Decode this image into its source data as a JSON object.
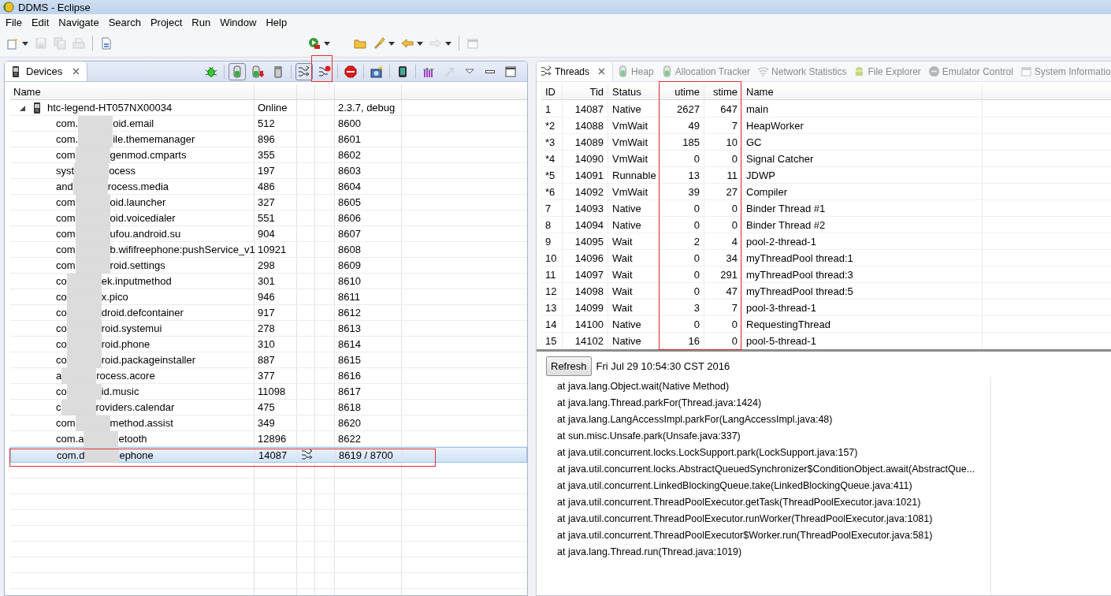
{
  "window": {
    "title": "DDMS - Eclipse"
  },
  "menu": [
    "File",
    "Edit",
    "Navigate",
    "Search",
    "Project",
    "Run",
    "Window",
    "Help"
  ],
  "main_toolbar": [
    {
      "kind": "new",
      "dropdown": true,
      "disabled": false
    },
    {
      "kind": "save",
      "dropdown": false,
      "disabled": true
    },
    {
      "kind": "save-all",
      "dropdown": false,
      "disabled": true
    },
    {
      "kind": "print",
      "dropdown": false,
      "disabled": true
    },
    {
      "kind": "separator"
    },
    {
      "kind": "document",
      "dropdown": false,
      "disabled": false
    },
    {
      "kind": "gap"
    },
    {
      "kind": "run",
      "dropdown": true,
      "disabled": false
    },
    {
      "kind": "gap-small"
    },
    {
      "kind": "folder",
      "dropdown": false,
      "disabled": false
    },
    {
      "kind": "torch",
      "dropdown": true,
      "disabled": false
    },
    {
      "kind": "back",
      "dropdown": true,
      "disabled": false
    },
    {
      "kind": "forward",
      "dropdown": true,
      "disabled": true
    },
    {
      "kind": "separator"
    },
    {
      "kind": "window",
      "dropdown": false,
      "disabled": true
    }
  ],
  "devices": {
    "tab": {
      "label": "Devices"
    },
    "toolbar": [
      {
        "kind": "bug",
        "pressed": false,
        "disabled": false
      },
      {
        "kind": "separator"
      },
      {
        "kind": "heap",
        "pressed": true,
        "disabled": false
      },
      {
        "kind": "dump",
        "pressed": false,
        "disabled": false
      },
      {
        "kind": "gc",
        "pressed": false,
        "disabled": false
      },
      {
        "kind": "separator"
      },
      {
        "kind": "threads",
        "pressed": true,
        "disabled": false
      },
      {
        "kind": "threads-stop",
        "pressed": false,
        "disabled": false
      },
      {
        "kind": "separator"
      },
      {
        "kind": "stop",
        "pressed": false,
        "disabled": false
      },
      {
        "kind": "separator"
      },
      {
        "kind": "camera",
        "pressed": false,
        "disabled": false
      },
      {
        "kind": "separator"
      },
      {
        "kind": "device",
        "pressed": false,
        "disabled": false
      },
      {
        "kind": "separator"
      },
      {
        "kind": "bars",
        "pressed": false,
        "disabled": false
      },
      {
        "kind": "arrow",
        "pressed": false,
        "disabled": true
      },
      {
        "kind": "viewmenu",
        "pressed": false,
        "disabled": false
      },
      {
        "kind": "minimize",
        "pressed": false,
        "disabled": false
      },
      {
        "kind": "maximize",
        "pressed": false,
        "disabled": false
      }
    ],
    "columns": [
      "Name"
    ],
    "device": {
      "name": "htc-legend-HT057NX00034",
      "status": "Online",
      "version": "2.3.7, debug",
      "expanded": true
    },
    "processes": [
      {
        "head": "com.",
        "tail": "oid.email",
        "pid": "512",
        "port": "8600",
        "selected": false,
        "threads": false
      },
      {
        "head": "com.",
        "tail": "ile.thememanager",
        "pid": "896",
        "port": "8601",
        "selected": false,
        "threads": false
      },
      {
        "head": "com",
        "tail": "genmod.cmparts",
        "pid": "355",
        "port": "8602",
        "selected": false,
        "threads": false
      },
      {
        "head": "syst",
        "tail": "ocess",
        "pid": "197",
        "port": "8603",
        "selected": false,
        "threads": false
      },
      {
        "head": "and",
        "tail": "rocess.media",
        "pid": "486",
        "port": "8604",
        "selected": false,
        "threads": false
      },
      {
        "head": "com",
        "tail": "oid.launcher",
        "pid": "327",
        "port": "8605",
        "selected": false,
        "threads": false
      },
      {
        "head": "com",
        "tail": "oid.voicedialer",
        "pid": "551",
        "port": "8606",
        "selected": false,
        "threads": false
      },
      {
        "head": "com",
        "tail": "ufou.android.su",
        "pid": "904",
        "port": "8607",
        "selected": false,
        "threads": false
      },
      {
        "head": "com",
        "tail": "b.wififreephone:pushService_v1",
        "pid": "10921",
        "port": "8608",
        "selected": false,
        "threads": false
      },
      {
        "head": "com",
        "tail": "roid.settings",
        "pid": "298",
        "port": "8609",
        "selected": false,
        "threads": false
      },
      {
        "head": "co",
        "tail": "ek.inputmethod",
        "pid": "301",
        "port": "8610",
        "selected": false,
        "threads": false
      },
      {
        "head": "co",
        "tail": "x.pico",
        "pid": "946",
        "port": "8611",
        "selected": false,
        "threads": false
      },
      {
        "head": "co",
        "tail": "droid.defcontainer",
        "pid": "917",
        "port": "8612",
        "selected": false,
        "threads": false
      },
      {
        "head": "co",
        "tail": "roid.systemui",
        "pid": "278",
        "port": "8613",
        "selected": false,
        "threads": false
      },
      {
        "head": "co",
        "tail": "roid.phone",
        "pid": "310",
        "port": "8614",
        "selected": false,
        "threads": false
      },
      {
        "head": "co",
        "tail": "roid.packageinstaller",
        "pid": "887",
        "port": "8615",
        "selected": false,
        "threads": false
      },
      {
        "head": "a",
        "tail": "rocess.acore",
        "pid": "377",
        "port": "8616",
        "selected": false,
        "threads": false
      },
      {
        "head": "co",
        "tail": "id.music",
        "pid": "11098",
        "port": "8617",
        "selected": false,
        "threads": false
      },
      {
        "head": "c",
        "tail": "roviders.calendar",
        "pid": "475",
        "port": "8618",
        "selected": false,
        "threads": false
      },
      {
        "head": "com",
        "tail": "method.assist",
        "pid": "349",
        "port": "8620",
        "selected": false,
        "threads": false
      },
      {
        "head": "com.a",
        "tail": "etooth",
        "pid": "12896",
        "port": "8622",
        "selected": false,
        "threads": false
      },
      {
        "head": "com.d",
        "tail": "ephone",
        "pid": "14087",
        "port": "8619 / 8700",
        "selected": true,
        "threads": true
      }
    ]
  },
  "threads": {
    "tabs": [
      {
        "label": "Threads",
        "kind": "threads",
        "selected": true
      },
      {
        "label": "Heap",
        "kind": "heap",
        "selected": false
      },
      {
        "label": "Allocation Tracker",
        "kind": "heap",
        "selected": false
      },
      {
        "label": "Network Statistics",
        "kind": "wifi",
        "selected": false
      },
      {
        "label": "File Explorer",
        "kind": "android",
        "selected": false
      },
      {
        "label": "Emulator Control",
        "kind": "disc",
        "selected": false
      },
      {
        "label": "System Informatio",
        "kind": "window",
        "selected": false
      }
    ],
    "columns": [
      "ID",
      "Tid",
      "Status",
      "utime",
      "stime",
      "Name"
    ],
    "rows": [
      [
        "1",
        "14087",
        "Native",
        "2627",
        "647",
        "main"
      ],
      [
        "*2",
        "14088",
        "VmWait",
        "49",
        "7",
        "HeapWorker"
      ],
      [
        "*3",
        "14089",
        "VmWait",
        "185",
        "10",
        "GC"
      ],
      [
        "*4",
        "14090",
        "VmWait",
        "0",
        "0",
        "Signal Catcher"
      ],
      [
        "*5",
        "14091",
        "Runnable",
        "13",
        "11",
        "JDWP"
      ],
      [
        "*6",
        "14092",
        "VmWait",
        "39",
        "27",
        "Compiler"
      ],
      [
        "7",
        "14093",
        "Native",
        "0",
        "0",
        "Binder Thread #1"
      ],
      [
        "8",
        "14094",
        "Native",
        "0",
        "0",
        "Binder Thread #2"
      ],
      [
        "9",
        "14095",
        "Wait",
        "2",
        "4",
        "pool-2-thread-1"
      ],
      [
        "10",
        "14096",
        "Wait",
        "0",
        "34",
        "myThreadPool thread:1"
      ],
      [
        "11",
        "14097",
        "Wait",
        "0",
        "291",
        "myThreadPool thread:3"
      ],
      [
        "12",
        "14098",
        "Wait",
        "0",
        "47",
        "myThreadPool thread:5"
      ],
      [
        "13",
        "14099",
        "Wait",
        "3",
        "7",
        "pool-3-thread-1"
      ],
      [
        "14",
        "14100",
        "Native",
        "0",
        "0",
        "RequestingThread"
      ],
      [
        "15",
        "14102",
        "Native",
        "16",
        "0",
        "pool-5-thread-1"
      ]
    ],
    "refresh": "Refresh",
    "timestamp": "Fri Jul 29 10:54:30 CST 2016",
    "stack_trace": [
      "at java.lang.Object.wait(Native Method)",
      "at java.lang.Thread.parkFor(Thread.java:1424)",
      "at java.lang.LangAccessImpl.parkFor(LangAccessImpl.java:48)",
      "at sun.misc.Unsafe.park(Unsafe.java:337)",
      "at java.util.concurrent.locks.LockSupport.park(LockSupport.java:157)",
      "at java.util.concurrent.locks.AbstractQueuedSynchronizer$ConditionObject.await(AbstractQue...",
      "at java.util.concurrent.LinkedBlockingQueue.take(LinkedBlockingQueue.java:411)",
      "at java.util.concurrent.ThreadPoolExecutor.getTask(ThreadPoolExecutor.java:1021)",
      "at java.util.concurrent.ThreadPoolExecutor.runWorker(ThreadPoolExecutor.java:1081)",
      "at java.util.concurrent.ThreadPoolExecutor$Worker.run(ThreadPoolExecutor.java:581)",
      "at java.lang.Thread.run(Thread.java:1019)"
    ]
  }
}
